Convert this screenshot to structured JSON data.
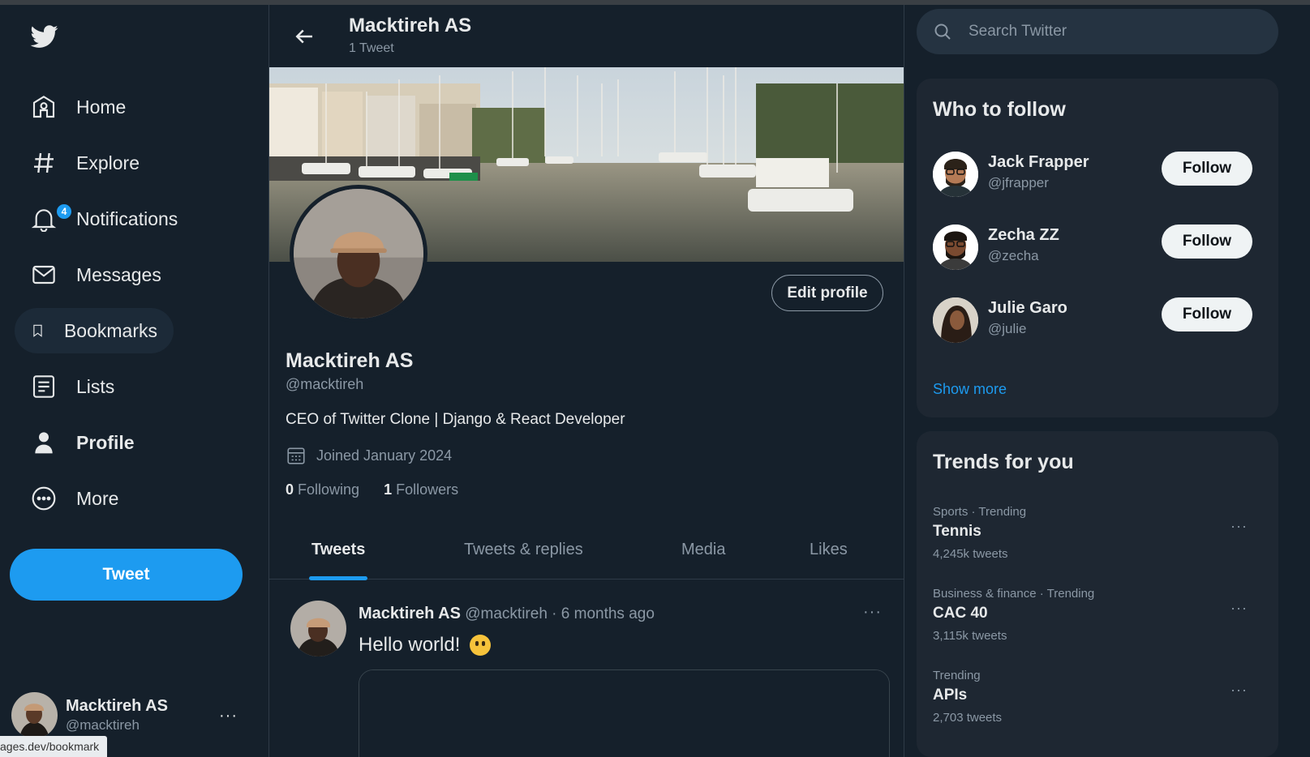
{
  "colors": {
    "background": "#15202b",
    "accent": "#1d9bf0",
    "card": "#1e2732"
  },
  "nav": {
    "items": [
      {
        "label": "Home",
        "icon": "home-icon"
      },
      {
        "label": "Explore",
        "icon": "hashtag-icon"
      },
      {
        "label": "Notifications",
        "icon": "bell-icon",
        "badge": "4"
      },
      {
        "label": "Messages",
        "icon": "mail-icon"
      },
      {
        "label": "Bookmarks",
        "icon": "bookmark-icon"
      },
      {
        "label": "Lists",
        "icon": "list-icon"
      },
      {
        "label": "Profile",
        "icon": "person-icon"
      },
      {
        "label": "More",
        "icon": "more-circle-icon"
      }
    ],
    "tweet_button": "Tweet"
  },
  "account": {
    "name": "Macktireh AS",
    "handle": "@macktireh",
    "menu": "···"
  },
  "status_url": "ages.dev/bookmark",
  "header": {
    "title": "Macktireh AS",
    "tweet_count": "1 Tweet"
  },
  "profile": {
    "edit_button": "Edit profile",
    "name": "Macktireh AS",
    "handle": "@macktireh",
    "bio": "CEO of Twitter Clone | Django & React Developer",
    "joined": "Joined January 2024",
    "following_count": "0",
    "following_label": "Following",
    "followers_count": "1",
    "followers_label": "Followers"
  },
  "tabs": [
    {
      "label": "Tweets",
      "active": true
    },
    {
      "label": "Tweets & replies",
      "active": false
    },
    {
      "label": "Media",
      "active": false
    },
    {
      "label": "Likes",
      "active": false
    }
  ],
  "tweet": {
    "author": "Macktireh AS",
    "meta": "@macktireh · 6 months ago",
    "text": "Hello world!",
    "more": "···"
  },
  "search": {
    "placeholder": "Search Twitter"
  },
  "who_to_follow": {
    "title": "Who to follow",
    "users": [
      {
        "name": "Jack Frapper",
        "handle": "@jfrapper",
        "button": "Follow"
      },
      {
        "name": "Zecha ZZ",
        "handle": "@zecha",
        "button": "Follow"
      },
      {
        "name": "Julie Garo",
        "handle": "@julie",
        "button": "Follow"
      }
    ],
    "show_more": "Show more"
  },
  "trends": {
    "title": "Trends for you",
    "items": [
      {
        "meta": "Sports · Trending",
        "topic": "Tennis",
        "count": "4,245k tweets"
      },
      {
        "meta": "Business & finance · Trending",
        "topic": "CAC 40",
        "count": "3,115k tweets"
      },
      {
        "meta": "Trending",
        "topic": "APIs",
        "count": "2,703 tweets"
      }
    ]
  }
}
